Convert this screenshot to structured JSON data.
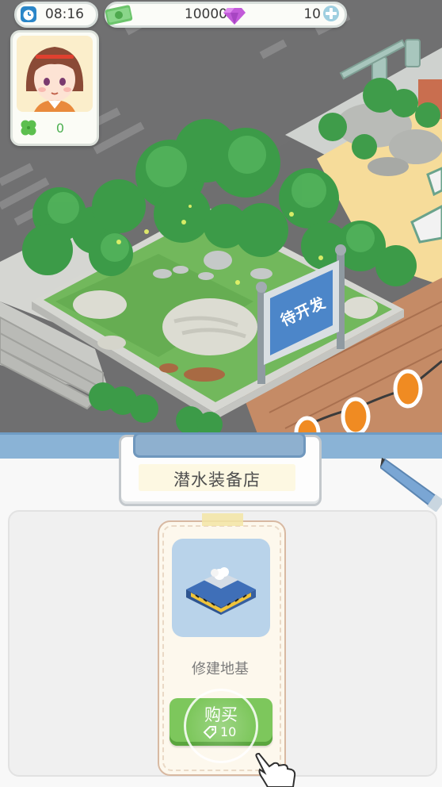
{
  "hud": {
    "time": "08:16",
    "money": "10000",
    "gems": "10",
    "clover_count": "0"
  },
  "sign": {
    "text": "待开发"
  },
  "shop": {
    "title": "潜水装备店",
    "item": {
      "name": "修建地基",
      "buy_label": "购买",
      "price": "10"
    }
  },
  "colors": {
    "buy_button": "#7dc75c",
    "sign_blue": "#4c86c9",
    "item_tile": "#b9d3ea",
    "panel_rail": "#8ab3d6"
  },
  "icons": [
    "clock-icon",
    "cash-icon",
    "gem-icon",
    "plus-icon",
    "clover-icon",
    "ticket-icon",
    "pointer-hand-icon"
  ]
}
